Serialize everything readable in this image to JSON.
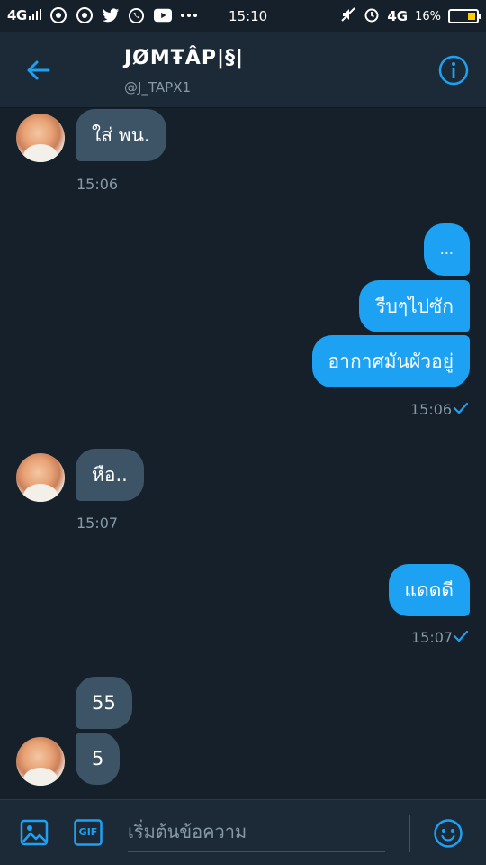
{
  "status_bar": {
    "network": "4G",
    "time": "15:10",
    "right_network": "4G",
    "battery": "16%",
    "icons": [
      "chrome-icon",
      "chrome-icon",
      "twitter-icon",
      "whatsapp-icon",
      "youtube-icon",
      "more-icon",
      "mute-icon",
      "alarm-icon",
      "battery-icon"
    ]
  },
  "header": {
    "name": "JØMŦÂP|§|",
    "handle": "@J_TAPX1",
    "back_icon": "arrow-left-icon",
    "info_icon": "info-icon"
  },
  "messages": [
    {
      "side": "in",
      "text": "ใส่ พน."
    },
    {
      "timestamp": "15:06"
    },
    {
      "side": "out",
      "text": "..."
    },
    {
      "side": "out",
      "text": "รีบๆไปซัก"
    },
    {
      "side": "out",
      "text": "อากาศมันผัวอยู่"
    },
    {
      "timestamp": "15:06",
      "read": true
    },
    {
      "side": "in",
      "text": "หือ.."
    },
    {
      "timestamp": "15:07"
    },
    {
      "side": "out",
      "text": "แดดดี"
    },
    {
      "timestamp": "15:07",
      "read": true
    },
    {
      "side": "in",
      "text": "55"
    },
    {
      "side": "in",
      "text": "5"
    }
  ],
  "composer": {
    "placeholder": "เริ่มต้นข้อความ",
    "gif_label": "GIF"
  },
  "colors": {
    "background": "#15202b",
    "header": "#1c2a38",
    "accent": "#1da1f2",
    "incoming_bubble": "#3d5466",
    "muted_text": "#8899a6"
  }
}
